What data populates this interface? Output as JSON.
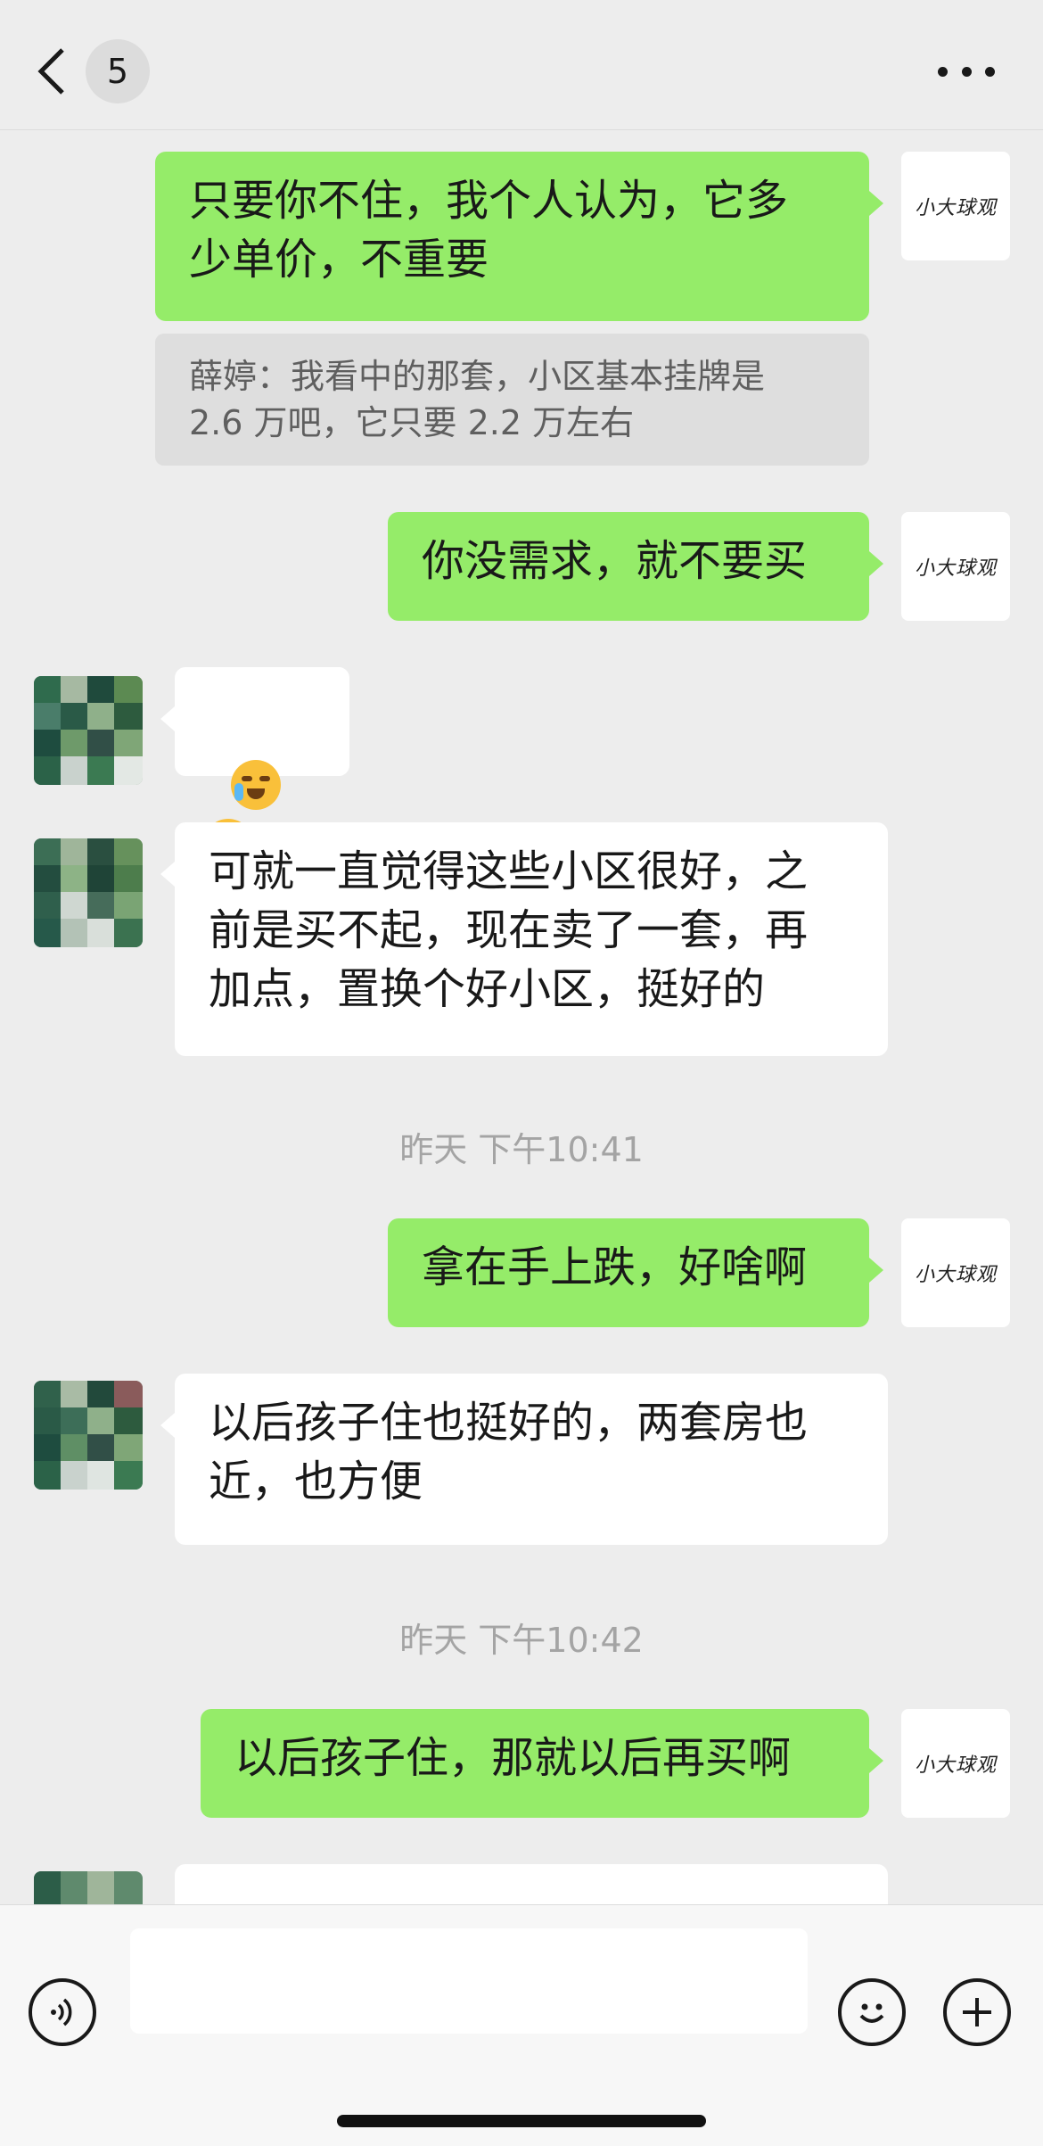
{
  "header": {
    "unread_count": "5",
    "title": ""
  },
  "avatars": {
    "me_label": "小大球观"
  },
  "messages": [
    {
      "from": "me",
      "text": "只要你不住，我个人认为，它多\n少单价，不重要"
    },
    {
      "from": "quote",
      "text": "薛婷：我看中的那套，小区基本挂牌是\n2.6 万吧，它只要 2.2 万左右"
    },
    {
      "from": "me",
      "text": "你没需求，就不要买"
    },
    {
      "from": "other",
      "emoji": "face-palm-crying-emoji x2"
    },
    {
      "from": "other",
      "text": "可就一直觉得这些小区很好，之\n前是买不起，现在卖了一套，再\n加点，置换个好小区，挺好的"
    },
    {
      "from": "me",
      "text": "拿在手上跌，好啥啊"
    },
    {
      "from": "other",
      "text": "以后孩子住也挺好的，两套房也\n近，也方便"
    },
    {
      "from": "me",
      "text": "以后孩子住，那就以后再买啊"
    }
  ],
  "timestamps": [
    "昨天 下午10:41",
    "昨天 下午10:42"
  ],
  "input": {
    "value": "",
    "placeholder": ""
  },
  "colors": {
    "background": "#ededed",
    "my_bubble": "#95ec69",
    "other_bubble": "#ffffff",
    "timestamp": "#a4a4a4"
  }
}
